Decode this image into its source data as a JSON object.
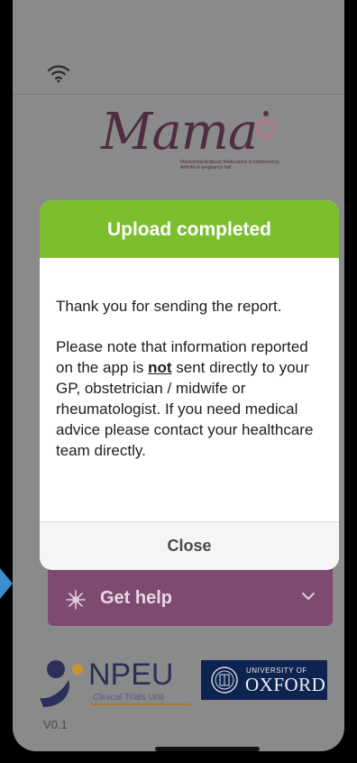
{
  "status_bar": {
    "wifi_icon": "wifi-icon"
  },
  "branding": {
    "app_name": "Mama",
    "app_tagline": "Monoclonal Antibody Medications in Inflammatory Arthritis in pregnancy trail",
    "accent_color": "#7e4a70"
  },
  "modal": {
    "title": "Upload completed",
    "header_color": "#7cbf2e",
    "message": "Thank you for sending the report.",
    "note_before": "Please note that information reported on the app is ",
    "note_emphasis": "not",
    "note_after": " sent directly to your GP, obstetrician / midwife or rheumatologist. If you need medical advice please contact your healthcare team directly.",
    "close_label": "Close"
  },
  "get_help": {
    "label": "Get help",
    "icon": "asterisk-icon",
    "chevron": "chevron-down-icon"
  },
  "footer": {
    "npeu_name": "NPEU",
    "npeu_subtitle": "Clinical Trials Unit",
    "oxford_small": "UNIVERSITY OF",
    "oxford_big": "OXFORD",
    "version": "V0.1"
  }
}
